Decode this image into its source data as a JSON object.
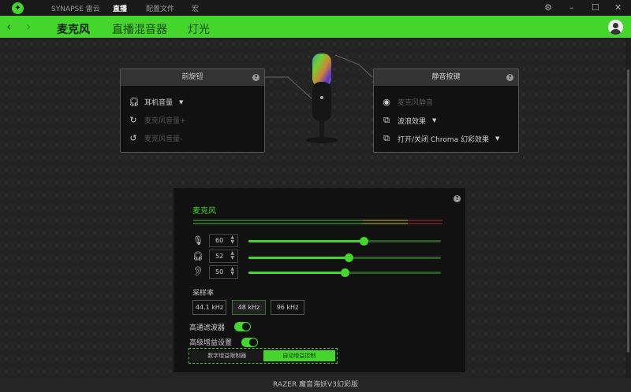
{
  "titlebar": {
    "nav": [
      "SYNAPSE 雷云",
      "直播",
      "配置文件",
      "宏"
    ],
    "active": "直播"
  },
  "tabs": {
    "items": [
      "麦克风",
      "直播混音器",
      "灯光"
    ],
    "active": "麦克风"
  },
  "front_knob": {
    "title": "前旋钮",
    "items": [
      {
        "label": "耳机音量",
        "enabled": true
      },
      {
        "label": "麦克风音量+",
        "enabled": false
      },
      {
        "label": "麦克风音量-",
        "enabled": false
      }
    ]
  },
  "mute_button": {
    "title": "静音按键",
    "items": [
      {
        "label": "麦克风静音",
        "enabled": false
      },
      {
        "label": "波浪效果",
        "enabled": true
      },
      {
        "label": "打开/关闭 Chroma 幻彩效果",
        "enabled": true
      }
    ]
  },
  "mic_panel": {
    "title": "麦克风",
    "mic_gain": "60",
    "headphone_volume": "52",
    "monitor_volume": "50",
    "sample_rate_label": "采样率",
    "sample_rates": [
      "44.1 kHz",
      "48 kHz",
      "96 kHz"
    ],
    "selected_rate": "48 kHz",
    "high_pass_label": "高通滤波器",
    "high_pass_on": true,
    "advanced_gain_label": "高级增益设置",
    "advanced_gain_on": true,
    "gain_modes": [
      "数字增益限制器",
      "自动增益控制"
    ],
    "selected_gain_mode": "自动增益控制"
  },
  "colors": {
    "accent": "#44d62c"
  },
  "footer": {
    "device": "RAZER 魔音海妖V3幻彩版"
  }
}
